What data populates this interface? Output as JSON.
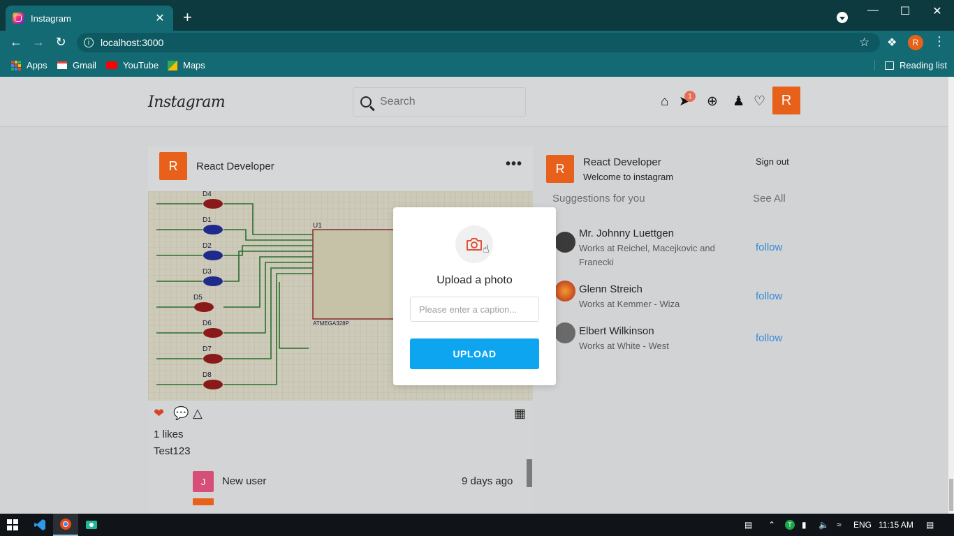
{
  "browser": {
    "tab_title": "Instagram",
    "tab_close": "✕",
    "new_tab": "+",
    "url": "localhost:3000",
    "avatar_letter": "R",
    "bookmarks": [
      "Apps",
      "Gmail",
      "YouTube",
      "Maps"
    ],
    "reading_list": "Reading list"
  },
  "header": {
    "logo": "Instagram",
    "search_placeholder": "Search",
    "notification_count": "1",
    "user_initial": "R"
  },
  "post": {
    "avatar": "R",
    "username": "React Developer",
    "likes": "1 likes",
    "caption": "Test123",
    "comment": {
      "avatar": "J",
      "username": "New user",
      "time": "9 days ago"
    },
    "image_labels": {
      "leds": [
        "D4",
        "D1",
        "D2",
        "D3",
        "D5",
        "D6",
        "D7",
        "D8"
      ],
      "chip": "U1",
      "chip_part": "ATMEGA328P"
    }
  },
  "sidebar": {
    "avatar": "R",
    "username": "React Developer",
    "subtitle": "Welcome to instagram",
    "signout": "Sign out",
    "suggestions_title": "Suggestions for you",
    "see_all": "See All",
    "suggestions": [
      {
        "name": "Mr. Johnny Luettgen",
        "work": "Works at Reichel, Macejkovic and Franecki",
        "action": "follow"
      },
      {
        "name": "Glenn Streich",
        "work": "Works at Kemmer - Wiza",
        "action": "follow"
      },
      {
        "name": "Elbert Wilkinson",
        "work": "Works at White - West",
        "action": "follow"
      }
    ]
  },
  "modal": {
    "title": "Upload a photo",
    "caption_placeholder": "Please enter a caption...",
    "upload_label": "UPLOAD"
  },
  "taskbar": {
    "language": "ENG",
    "time": "11:15 AM"
  },
  "colors": {
    "accent_orange": "#e8611a",
    "upload_blue": "#0ea5f0",
    "follow_blue": "#3b8bd6",
    "chrome_teal": "#136a73"
  }
}
